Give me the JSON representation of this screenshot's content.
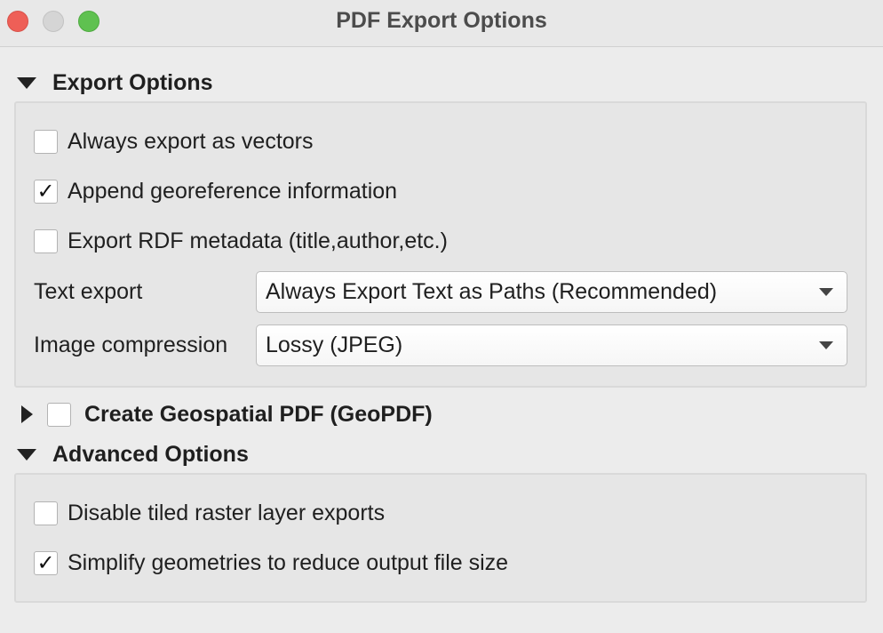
{
  "window": {
    "title": "PDF Export Options"
  },
  "export_options": {
    "header": "Export Options",
    "expanded": true,
    "checkboxes": [
      {
        "label": "Always export as vectors",
        "checked": false,
        "mark": ""
      },
      {
        "label": "Append georeference information",
        "checked": true,
        "mark": "✓"
      },
      {
        "label": "Export RDF metadata (title,author,etc.)",
        "checked": false,
        "mark": ""
      }
    ],
    "text_export": {
      "label": "Text export",
      "value": "Always Export Text as Paths (Recommended)"
    },
    "image_compression": {
      "label": "Image compression",
      "value": "Lossy (JPEG)"
    }
  },
  "geopdf": {
    "header": "Create Geospatial PDF (GeoPDF)",
    "expanded": false,
    "checked": false
  },
  "advanced_options": {
    "header": "Advanced Options",
    "expanded": true,
    "checkboxes": [
      {
        "label": "Disable tiled raster layer exports",
        "checked": false,
        "mark": ""
      },
      {
        "label": "Simplify geometries to reduce output file size",
        "checked": true,
        "mark": "✓"
      }
    ]
  },
  "icons": {
    "close": "close-button-icon",
    "minimize": "minimize-button-icon",
    "maximize": "zoom-button-icon",
    "expanded": "triangle-down-icon",
    "collapsed": "triangle-right-icon",
    "dropdown": "chevron-down-icon"
  },
  "colors": {
    "close": "#ee5f57",
    "minimize": "#d5d5d5",
    "maximize": "#5fc150",
    "background": "#ececec"
  }
}
